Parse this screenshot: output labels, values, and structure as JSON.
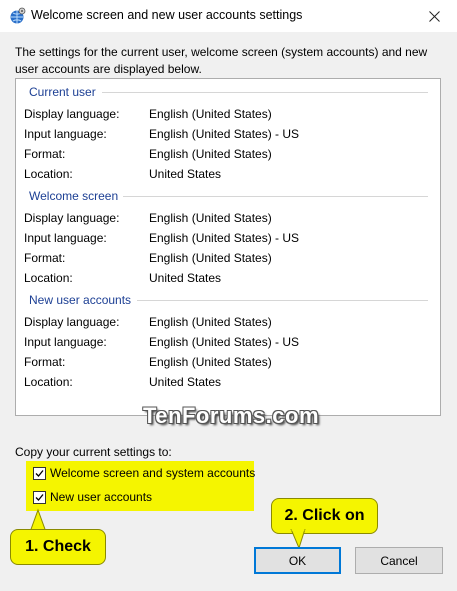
{
  "window": {
    "title": "Welcome screen and new user accounts settings"
  },
  "description": "The settings for the current user, welcome screen (system accounts) and new user accounts are displayed below.",
  "sections": [
    {
      "title": "Current user",
      "rows": [
        {
          "label": "Display language:",
          "value": "English (United States)"
        },
        {
          "label": "Input language:",
          "value": "English (United States) - US"
        },
        {
          "label": "Format:",
          "value": "English (United States)"
        },
        {
          "label": "Location:",
          "value": "United States"
        }
      ]
    },
    {
      "title": "Welcome screen",
      "rows": [
        {
          "label": "Display language:",
          "value": "English (United States)"
        },
        {
          "label": "Input language:",
          "value": "English (United States) - US"
        },
        {
          "label": "Format:",
          "value": "English (United States)"
        },
        {
          "label": "Location:",
          "value": "United States"
        }
      ]
    },
    {
      "title": "New user accounts",
      "rows": [
        {
          "label": "Display language:",
          "value": "English (United States)"
        },
        {
          "label": "Input language:",
          "value": "English (United States) - US"
        },
        {
          "label": "Format:",
          "value": "English (United States)"
        },
        {
          "label": "Location:",
          "value": "United States"
        }
      ]
    }
  ],
  "watermark": "TenForums.com",
  "copy": {
    "label": "Copy your current settings to:",
    "welcome_label": "Welcome screen and system accounts",
    "welcome_checked": true,
    "new_user_label": "New user accounts",
    "new_user_checked": true
  },
  "callouts": {
    "check": "1. Check",
    "click": "2. Click on"
  },
  "buttons": {
    "ok": "OK",
    "cancel": "Cancel"
  },
  "colors": {
    "section_heading": "#1c3f94",
    "highlight": "#f5f500",
    "ok_border": "#0078d7"
  },
  "icons": {
    "app": "globe-gear-icon",
    "close": "close-icon",
    "check": "checkmark-icon"
  }
}
